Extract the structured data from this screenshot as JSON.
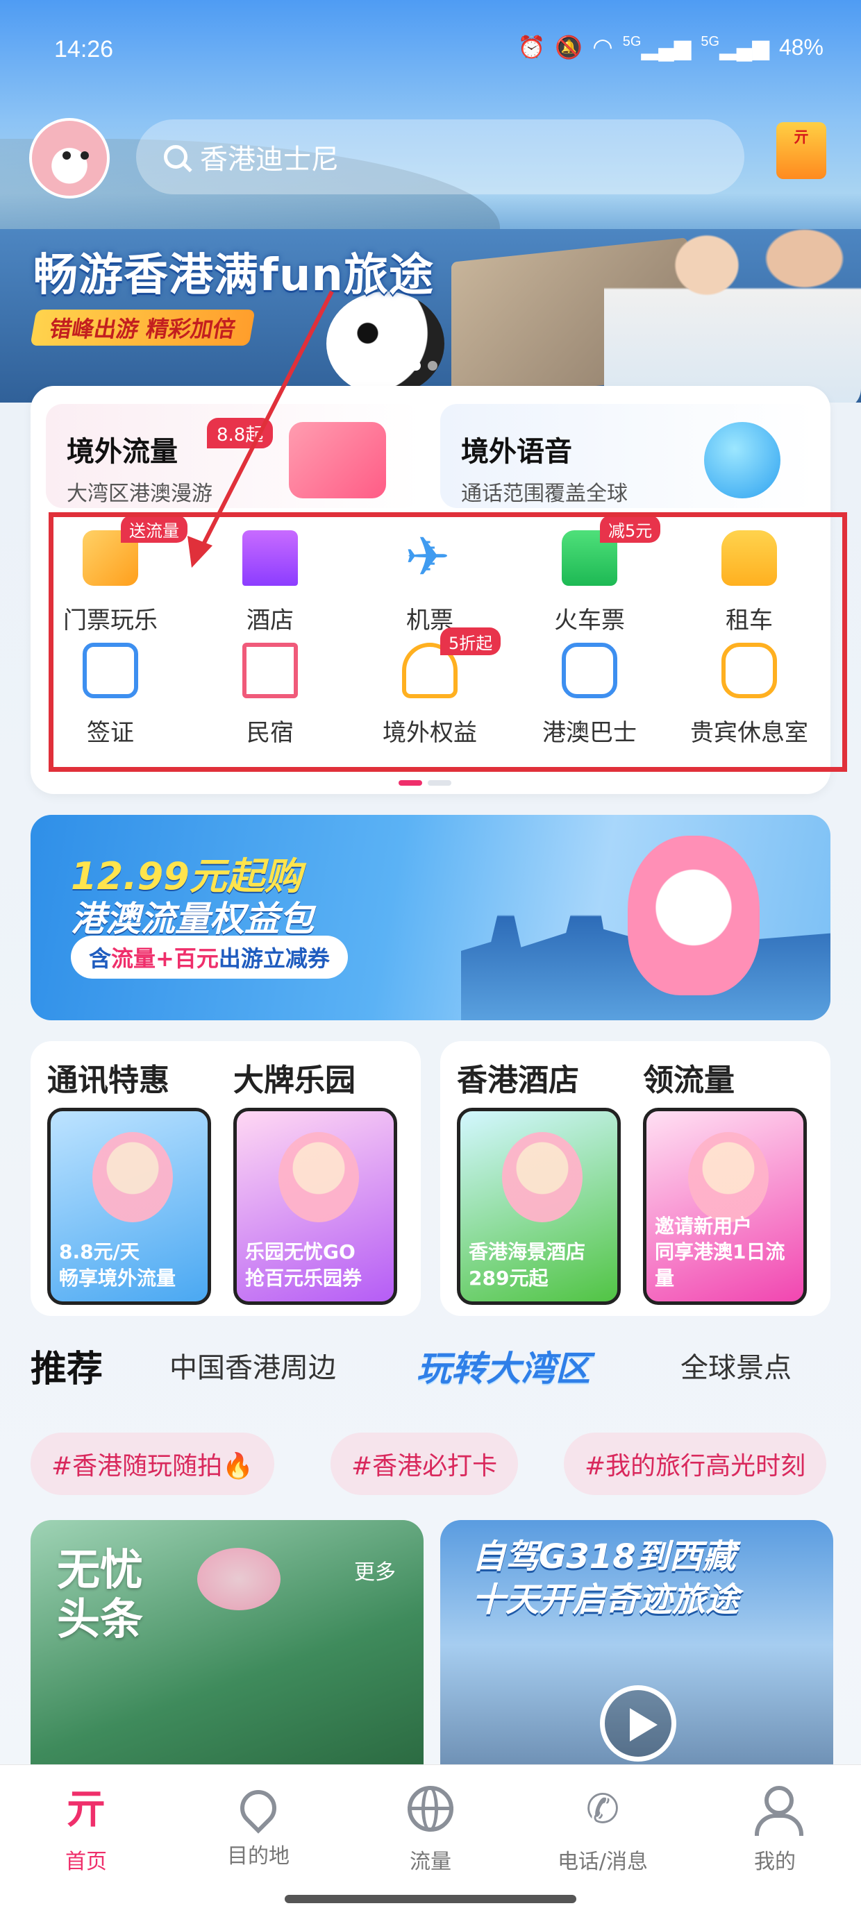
{
  "status_bar": {
    "time": "14:26",
    "icons": [
      "alarm-icon",
      "mute-icon",
      "wifi-icon",
      "5g-signal-icon",
      "5g-signal-icon"
    ],
    "battery": "48%",
    "signal_label_1": "5G",
    "signal_label_2": "5G"
  },
  "header": {
    "search_placeholder": "香港迪士尼",
    "gift_label": "亓"
  },
  "hero": {
    "title": "畅游香港满fun旅途",
    "subtitle": "错峰出游 精彩加倍"
  },
  "promos": [
    {
      "title": "境外流量",
      "subtitle": "大湾区港澳漫游",
      "badge": "8.8起"
    },
    {
      "title": "境外语音",
      "subtitle": "通话范围覆盖全球"
    }
  ],
  "services": [
    {
      "label": "门票玩乐",
      "tag": "送流量",
      "icon": "ticket-icon"
    },
    {
      "label": "酒店",
      "icon": "hotel-icon"
    },
    {
      "label": "机票",
      "icon": "plane-icon"
    },
    {
      "label": "火车票",
      "tag": "减5元",
      "icon": "train-icon"
    },
    {
      "label": "租车",
      "icon": "car-icon"
    },
    {
      "label": "签证",
      "icon": "visa-icon"
    },
    {
      "label": "民宿",
      "icon": "homestay-icon"
    },
    {
      "label": "境外权益",
      "tag": "5折起",
      "icon": "rights-icon"
    },
    {
      "label": "港澳巴士",
      "icon": "bus-icon"
    },
    {
      "label": "贵宾休息室",
      "icon": "lounge-icon"
    }
  ],
  "banner": {
    "line1": "12.99元起购",
    "line2": "港澳流量权益包",
    "pill_prefix": "含",
    "pill_highlight": "流量+百元",
    "pill_suffix": "出游立减券"
  },
  "categories": [
    {
      "heading": "通讯特惠",
      "tile_caption_1": "8.8元/天",
      "tile_caption_2": "畅享境外流量"
    },
    {
      "heading": "大牌乐园",
      "tile_caption_1": "乐园无忧GO",
      "tile_caption_2": "抢百元乐园券"
    },
    {
      "heading": "香港酒店",
      "tile_caption_1": "香港海景酒店",
      "tile_caption_2": "289元起"
    },
    {
      "heading": "领流量",
      "tile_caption_1": "邀请新用户",
      "tile_caption_2": "同享港澳1日流量"
    }
  ],
  "tabs": [
    "推荐",
    "中国香港周边",
    "玩转大湾区",
    "全球景点"
  ],
  "chips": [
    "#香港随玩随拍🔥",
    "#香港必打卡",
    "#我的旅行高光时刻"
  ],
  "feed": [
    {
      "title_1": "无忧",
      "title_2": "头条",
      "more": "更多"
    },
    {
      "title_1": "自驾G318到西藏",
      "title_2": "十天开启奇迹旅途"
    }
  ],
  "bottom_nav": [
    {
      "label": "首页",
      "icon": "home-icon"
    },
    {
      "label": "目的地",
      "icon": "location-pin-icon"
    },
    {
      "label": "流量",
      "icon": "globe-icon"
    },
    {
      "label": "电话/消息",
      "icon": "phone-icon"
    },
    {
      "label": "我的",
      "icon": "user-icon"
    }
  ],
  "colors": {
    "accent": "#ef2f6b",
    "badge_red": "#e8334b",
    "highlight_box": "#e0303a",
    "blue": "#2f7fe8"
  }
}
